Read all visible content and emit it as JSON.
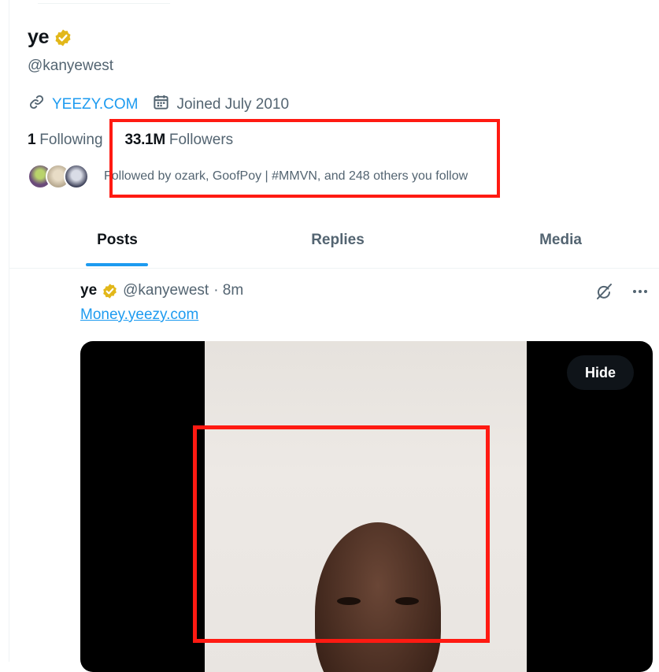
{
  "profile": {
    "display_name": "ye",
    "handle": "@kanyewest",
    "website": "YEEZY.COM",
    "joined": "Joined July 2010",
    "following_count": "1",
    "following_label": "Following",
    "followers_count": "33.1M",
    "followers_label": "Followers",
    "followed_by": "Followed by ozark, GoofPoy | #MMVN, and 248 others you follow"
  },
  "tabs": [
    {
      "label": "Posts",
      "active": true
    },
    {
      "label": "Replies",
      "active": false
    },
    {
      "label": "Media",
      "active": false
    }
  ],
  "tweet": {
    "name": "ye",
    "handle": "@kanyewest",
    "time": "· 8m",
    "link_text": "Money.yeezy.com",
    "hide_label": "Hide"
  },
  "colors": {
    "accent": "#1d9bf0",
    "verified": "#e2b719",
    "highlight": "#ff1a12"
  },
  "icons": {
    "verified": "verified-badge-icon",
    "link": "link-icon",
    "calendar": "calendar-icon",
    "grok": "grok-icon",
    "more": "more-icon"
  }
}
